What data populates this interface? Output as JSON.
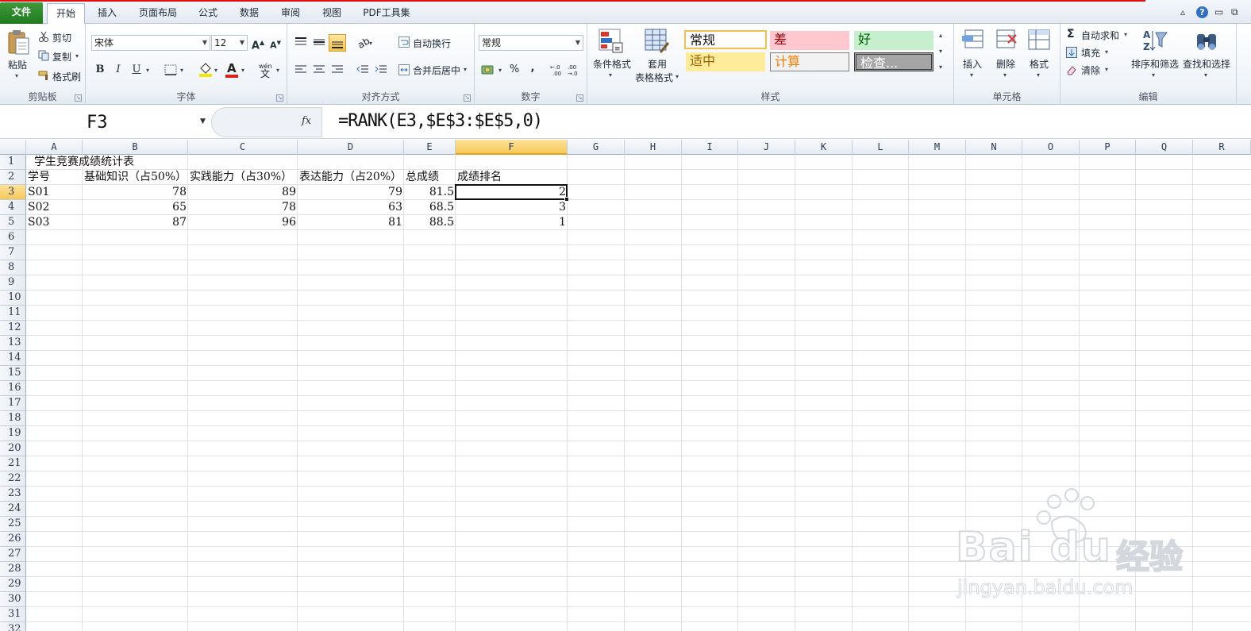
{
  "ribbon_tabs": {
    "file": "文件",
    "home": "开始",
    "insert": "插入",
    "page_layout": "页面布局",
    "formulas": "公式",
    "data": "数据",
    "review": "审阅",
    "view": "视图",
    "pdf": "PDF工具集"
  },
  "clipboard": {
    "paste": "粘贴",
    "cut": "剪切",
    "copy": "复制",
    "format_painter": "格式刷",
    "label": "剪贴板"
  },
  "font": {
    "name": "宋体",
    "size": "12",
    "bold": "B",
    "italic": "I",
    "underline": "U",
    "label": "字体",
    "font_color": "#e0201c",
    "fill_color": "#f5e600"
  },
  "alignment": {
    "wrap_text": "自动换行",
    "merge_center": "合并后居中",
    "label": "对齐方式"
  },
  "number": {
    "format": "常规",
    "percent": "%",
    "comma": ",",
    "label": "数字"
  },
  "styles": {
    "conditional": "条件格式",
    "table_format_1": "套用",
    "table_format_2": "表格格式",
    "label": "样式",
    "normal": "常规",
    "bad": "差",
    "good": "好",
    "neutral": "适中",
    "calculation": "计算",
    "check": "检查..."
  },
  "cells_group": {
    "insert": "插入",
    "delete": "删除",
    "format": "格式",
    "label": "单元格"
  },
  "editing": {
    "autosum": "自动求和",
    "fill": "填充",
    "clear": "清除",
    "sort_filter": "排序和筛选",
    "find_select": "查找和选择",
    "label": "编辑"
  },
  "formula_bar": {
    "name_box": "F3",
    "fx": "fx",
    "formula": "=RANK(E3,$E$3:$E$5,0)"
  },
  "columns": [
    "A",
    "B",
    "C",
    "D",
    "E",
    "F",
    "G",
    "H",
    "I",
    "J",
    "K",
    "L",
    "M",
    "N",
    "O",
    "P",
    "Q",
    "R"
  ],
  "rows": [
    "1",
    "2",
    "3",
    "4",
    "5",
    "6",
    "7",
    "8",
    "9",
    "10",
    "11",
    "12",
    "13",
    "14",
    "15",
    "16",
    "17",
    "18",
    "19",
    "20",
    "21",
    "22",
    "23",
    "24",
    "25",
    "26",
    "27",
    "28",
    "29",
    "30",
    "31",
    "32"
  ],
  "sheet": {
    "title": "学生竞赛成绩统计表",
    "headers": [
      "学号",
      "基础知识（占50%）",
      "实践能力（占30%）",
      "表达能力（占20%）",
      "总成绩",
      "成绩排名"
    ],
    "data": [
      [
        "S01",
        "78",
        "89",
        "79",
        "81.5",
        "2"
      ],
      [
        "S02",
        "65",
        "78",
        "63",
        "68.5",
        "3"
      ],
      [
        "S03",
        "87",
        "96",
        "81",
        "88.5",
        "1"
      ]
    ]
  },
  "watermark": {
    "brand": "Bai du",
    "cn": "经验",
    "url": "jingyan.baidu.com"
  }
}
